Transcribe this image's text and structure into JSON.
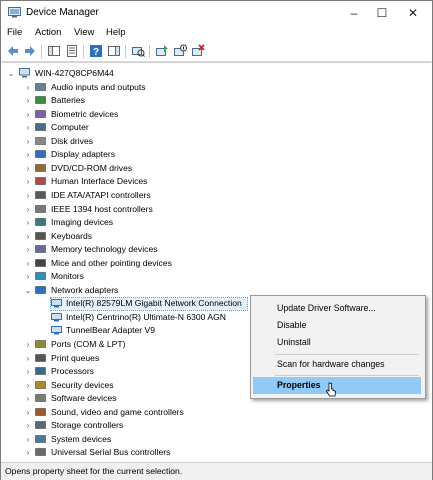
{
  "window": {
    "title": "Device Manager",
    "controls": {
      "minimize": "–",
      "maximize": "☐",
      "close": "✕"
    }
  },
  "menu": [
    "File",
    "Action",
    "View",
    "Help"
  ],
  "toolbar": {
    "buttons": [
      "back-icon",
      "forward-icon",
      "show-hide-console-tree-icon",
      "properties-icon",
      "help-icon",
      "action-pane-icon",
      "scan-hardware-icon",
      "update-driver-icon",
      "disable-device-icon",
      "uninstall-device-icon"
    ]
  },
  "tree": {
    "root": "WIN-427Q8CP6M44",
    "categories": [
      "Audio inputs and outputs",
      "Batteries",
      "Biometric devices",
      "Computer",
      "Disk drives",
      "Display adapters",
      "DVD/CD-ROM drives",
      "Human Interface Devices",
      "IDE ATA/ATAPI controllers",
      "IEEE 1394 host controllers",
      "Imaging devices",
      "Keyboards",
      "Memory technology devices",
      "Mice and other pointing devices",
      "Monitors",
      "Network adapters",
      "Ports (COM & LPT)",
      "Print queues",
      "Processors",
      "Security devices",
      "Software devices",
      "Sound, video and game controllers",
      "Storage controllers",
      "System devices",
      "Universal Serial Bus controllers"
    ],
    "network_children": [
      "Intel(R) 82579LM Gigabit Network Connection",
      "Intel(R) Centrino(R) Ultimate-N 6300 AGN",
      "TunnelBear Adapter V9"
    ]
  },
  "context_menu": {
    "items": [
      "Update Driver Software...",
      "Disable",
      "Uninstall",
      "Scan for hardware changes",
      "Properties"
    ],
    "highlighted": "Properties",
    "highlight_color": "#91c9f7"
  },
  "status": "Opens property sheet for the current selection."
}
